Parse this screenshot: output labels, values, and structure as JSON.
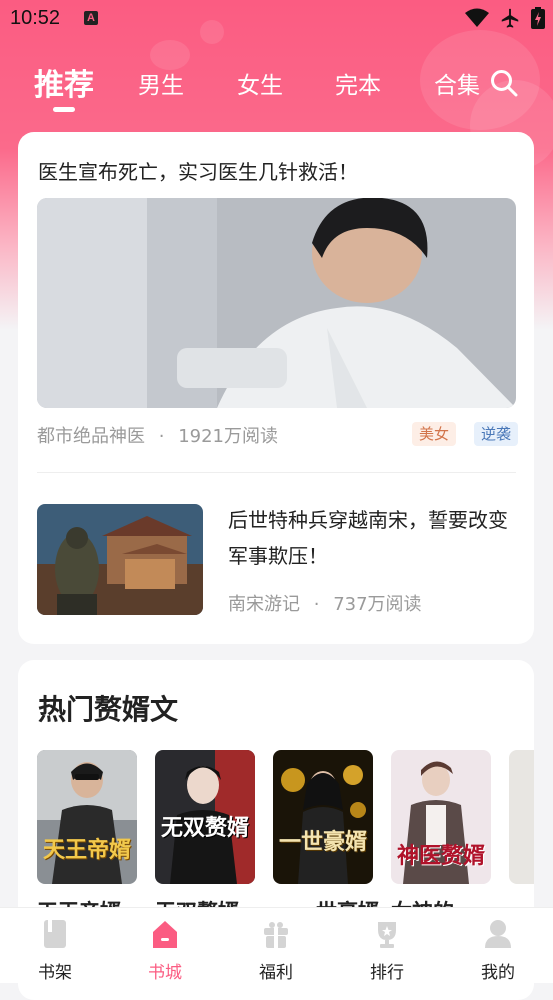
{
  "status_bar": {
    "time": "10:52",
    "badge": "A"
  },
  "tabs": [
    {
      "label": "推荐",
      "active": true
    },
    {
      "label": "男生"
    },
    {
      "label": "女生"
    },
    {
      "label": "完本"
    },
    {
      "label": "合集"
    }
  ],
  "feature": {
    "headline": "医生宣布死亡，实习医生几针救活！",
    "book": "都市绝品神医",
    "dot": "·",
    "reads": "1921万阅读",
    "tags": [
      "美女",
      "逆袭"
    ]
  },
  "second": {
    "headline": "后世特种兵穿越南宋，誓要改变军事欺压！",
    "book": "南宋游记",
    "dot": "·",
    "reads": "737万阅读"
  },
  "section": {
    "title": "热门赘婿文",
    "books": [
      {
        "title": "天王帝婿",
        "cover_text": "天王帝婿"
      },
      {
        "title": "无双赘婿",
        "cover_text": "无双赘婿"
      },
      {
        "title": "一世豪婿",
        "cover_text": "一世豪婿"
      },
      {
        "title": "女神的",
        "cover_text": "神医赘婿"
      }
    ]
  },
  "bottom_nav": [
    {
      "label": "书架",
      "icon": "bookshelf-icon"
    },
    {
      "label": "书城",
      "icon": "bookstore-icon",
      "active": true
    },
    {
      "label": "福利",
      "icon": "gift-icon"
    },
    {
      "label": "排行",
      "icon": "trophy-icon"
    },
    {
      "label": "我的",
      "icon": "profile-icon"
    }
  ],
  "colors": {
    "accent": "#fb5c82"
  }
}
